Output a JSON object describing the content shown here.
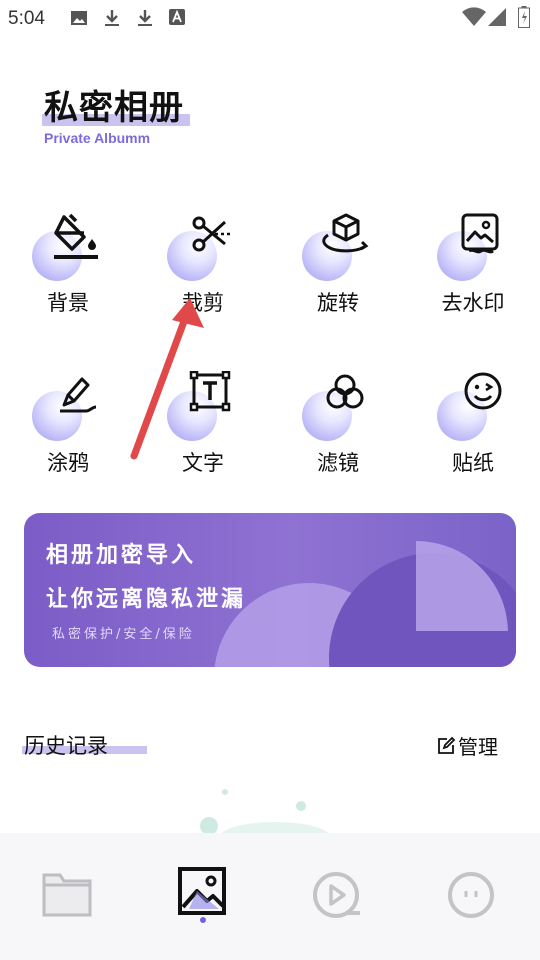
{
  "status_bar": {
    "time": "5:04",
    "icons": [
      "image-icon",
      "download-icon",
      "download-icon",
      "a-icon",
      "wifi-icon",
      "signal-icon",
      "battery-icon"
    ]
  },
  "header": {
    "title": "私密相册",
    "subtitle": "Private Albumm"
  },
  "tools": [
    {
      "label": "背景",
      "icon": "paint-bucket-icon"
    },
    {
      "label": "裁剪",
      "icon": "scissors-icon"
    },
    {
      "label": "旋转",
      "icon": "rotate-cube-icon"
    },
    {
      "label": "去水印",
      "icon": "image-watermark-icon"
    },
    {
      "label": "涂鸦",
      "icon": "pen-doodle-icon"
    },
    {
      "label": "文字",
      "icon": "text-box-icon"
    },
    {
      "label": "滤镜",
      "icon": "filter-circles-icon"
    },
    {
      "label": "贴纸",
      "icon": "smiley-sticker-icon"
    }
  ],
  "banner": {
    "line1": "相册加密导入",
    "line2": "让你远离隐私泄漏",
    "line3": "私密保护/安全/保险"
  },
  "history": {
    "title": "历史记录",
    "manage_label": "管理"
  },
  "bottom_nav": {
    "tabs": [
      {
        "name": "folder",
        "icon": "folder-icon",
        "active": false
      },
      {
        "name": "gallery",
        "icon": "image-icon",
        "active": true
      },
      {
        "name": "video",
        "icon": "video-play-icon",
        "active": false
      },
      {
        "name": "profile",
        "icon": "face-icon",
        "active": false
      }
    ]
  },
  "colors": {
    "accent": "#7b6cd9",
    "highlight": "#cbc3ef",
    "banner": "#8f72d2",
    "annotation_arrow": "#e0484a"
  }
}
